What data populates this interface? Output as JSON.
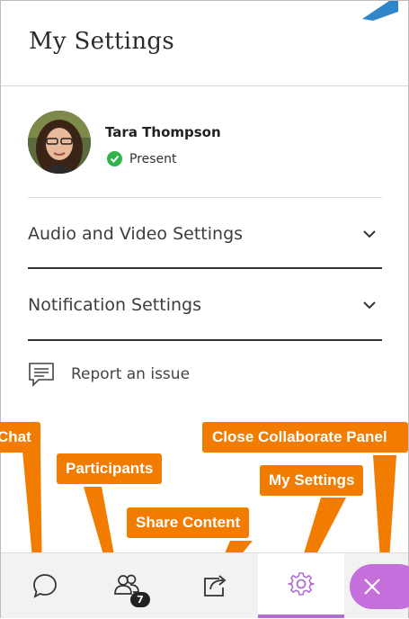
{
  "header": {
    "title": "My Settings"
  },
  "profile": {
    "name": "Tara Thompson",
    "status": "Present",
    "status_color": "#2fb44a"
  },
  "sections": [
    {
      "label": "Audio and Video Settings"
    },
    {
      "label": "Notification Settings"
    }
  ],
  "report": {
    "label": "Report an issue"
  },
  "callouts": {
    "chat": "Chat",
    "participants": "Participants",
    "share": "Share Content",
    "settings": "My Settings",
    "close": "Close Collaborate Panel"
  },
  "bottom_bar": {
    "participants_count": "7"
  },
  "colors": {
    "callout": "#f27c00",
    "accent_purple": "#c56fdd",
    "arrow_blue": "#2f86c8"
  }
}
